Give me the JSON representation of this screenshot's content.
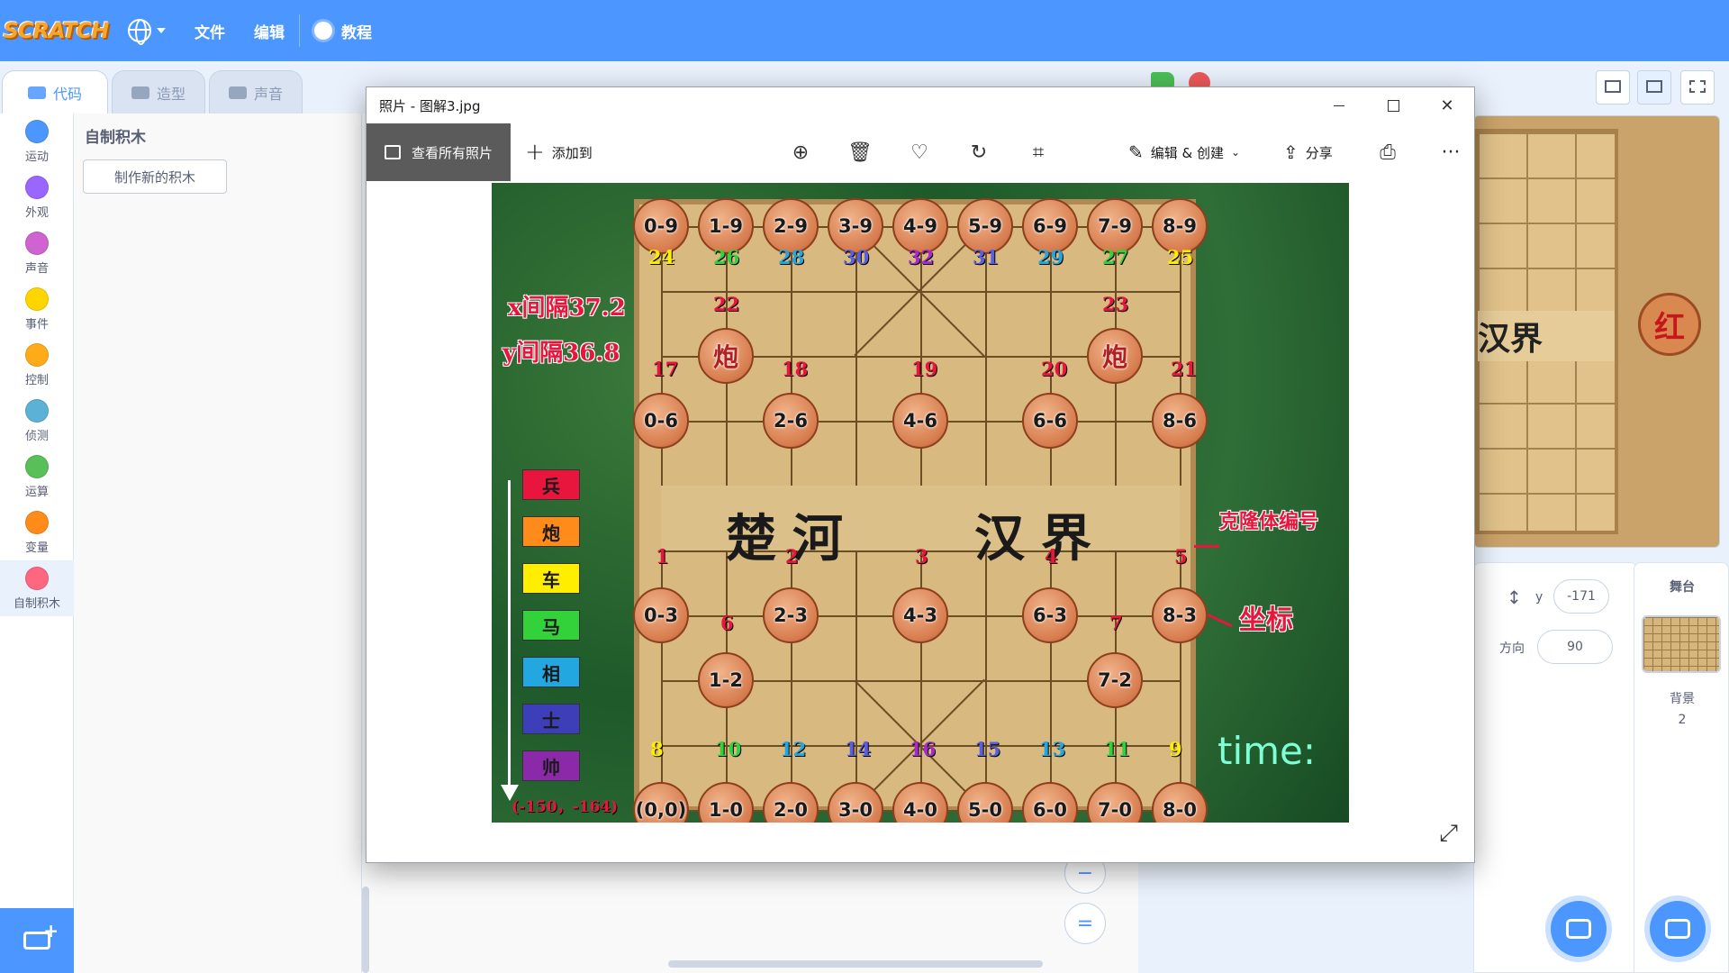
{
  "menubar": {
    "logo": "SCRATCH",
    "file": "文件",
    "edit": "编辑",
    "tutorials": "教程"
  },
  "tabs": {
    "code": "代码",
    "costumes": "造型",
    "sounds": "声音"
  },
  "categories": [
    {
      "label": "运动",
      "color": "#4c97ff"
    },
    {
      "label": "外观",
      "color": "#9966ff"
    },
    {
      "label": "声音",
      "color": "#cf63cf"
    },
    {
      "label": "事件",
      "color": "#ffd500"
    },
    {
      "label": "控制",
      "color": "#ffab19"
    },
    {
      "label": "侦测",
      "color": "#5cb1d6"
    },
    {
      "label": "运算",
      "color": "#59c059"
    },
    {
      "label": "变量",
      "color": "#ff8c1a"
    },
    {
      "label": "自制积木",
      "color": "#ff6680"
    }
  ],
  "palette": {
    "title": "自制积木",
    "make_block": "制作新的积木"
  },
  "codearea": {
    "zoom_out": "−",
    "zoom_reset": "="
  },
  "sprite_props": {
    "y_label": "y",
    "y_value": "-171",
    "direction_label": "方向",
    "direction_value": "90"
  },
  "stage_panel": {
    "title": "舞台",
    "backdrops_label": "背景",
    "backdrops_count": "2"
  },
  "stage_preview": {
    "river_text": "汉界",
    "piece_char": "红"
  },
  "photos": {
    "title": "照片 - 图解3.jpg",
    "view_all": "查看所有照片",
    "add_to": "添加到",
    "edit_create": "编辑 & 创建",
    "share": "分享",
    "more": "···",
    "close": "✕"
  },
  "chess_image": {
    "x_gap": "x间隔37.2",
    "y_gap": "y间隔36.8",
    "river_left": "楚河",
    "river_right": "汉界",
    "clone_label": "克隆体编号",
    "coord_label": "坐标",
    "time": "time:",
    "origin": "(-150，-164)",
    "legend": [
      {
        "char": "兵",
        "color": "#e8163c"
      },
      {
        "char": "炮",
        "color": "#ff8c1a"
      },
      {
        "char": "车",
        "color": "#ffee00"
      },
      {
        "char": "马",
        "color": "#33d13a"
      },
      {
        "char": "相",
        "color": "#22a7e0"
      },
      {
        "char": "士",
        "color": "#3c3fb8"
      },
      {
        "char": "帅",
        "color": "#8a2aa8"
      }
    ],
    "top_row": [
      {
        "coord": "0-9",
        "num": "24",
        "num_color": "#ffee00"
      },
      {
        "coord": "1-9",
        "num": "26",
        "num_color": "#33d13a"
      },
      {
        "coord": "2-9",
        "num": "28",
        "num_color": "#22a7e0"
      },
      {
        "coord": "3-9",
        "num": "30",
        "num_color": "#5a5fe0"
      },
      {
        "coord": "4-9",
        "num": "32",
        "num_color": "#a52ad0"
      },
      {
        "coord": "5-9",
        "num": "31",
        "num_color": "#5a5fe0"
      },
      {
        "coord": "6-9",
        "num": "29",
        "num_color": "#22a7e0"
      },
      {
        "coord": "7-9",
        "num": "27",
        "num_color": "#33d13a"
      },
      {
        "coord": "8-9",
        "num": "25",
        "num_color": "#ffee00"
      }
    ],
    "cannon_top": [
      {
        "coord": "",
        "num": "22",
        "char": "炮"
      },
      {
        "coord": "",
        "num": "23",
        "char": "炮"
      }
    ],
    "pawn_top": [
      {
        "coord": "0-6",
        "num": "17"
      },
      {
        "coord": "2-6",
        "num": "18"
      },
      {
        "coord": "4-6",
        "num": "19"
      },
      {
        "coord": "6-6",
        "num": "20"
      },
      {
        "coord": "8-6",
        "num": "21"
      }
    ],
    "pawn_bottom": [
      {
        "coord": "0-3",
        "num": "1"
      },
      {
        "coord": "2-3",
        "num": "2"
      },
      {
        "coord": "4-3",
        "num": "3"
      },
      {
        "coord": "6-3",
        "num": "4"
      },
      {
        "coord": "8-3",
        "num": "5"
      }
    ],
    "cannon_bottom": [
      {
        "coord": "1-2",
        "num": "6"
      },
      {
        "coord": "7-2",
        "num": "7"
      }
    ],
    "bottom_row": [
      {
        "coord": "(0,0)",
        "num": "8",
        "num_color": "#ffee00"
      },
      {
        "coord": "1-0",
        "num": "10",
        "num_color": "#33d13a"
      },
      {
        "coord": "2-0",
        "num": "12",
        "num_color": "#22a7e0"
      },
      {
        "coord": "3-0",
        "num": "14",
        "num_color": "#5a5fe0"
      },
      {
        "coord": "4-0",
        "num": "16",
        "num_color": "#a52ad0"
      },
      {
        "coord": "5-0",
        "num": "15",
        "num_color": "#5a5fe0"
      },
      {
        "coord": "6-0",
        "num": "13",
        "num_color": "#22a7e0"
      },
      {
        "coord": "7-0",
        "num": "11",
        "num_color": "#33d13a"
      },
      {
        "coord": "8-0",
        "num": "9",
        "num_color": "#ffee00"
      }
    ]
  }
}
